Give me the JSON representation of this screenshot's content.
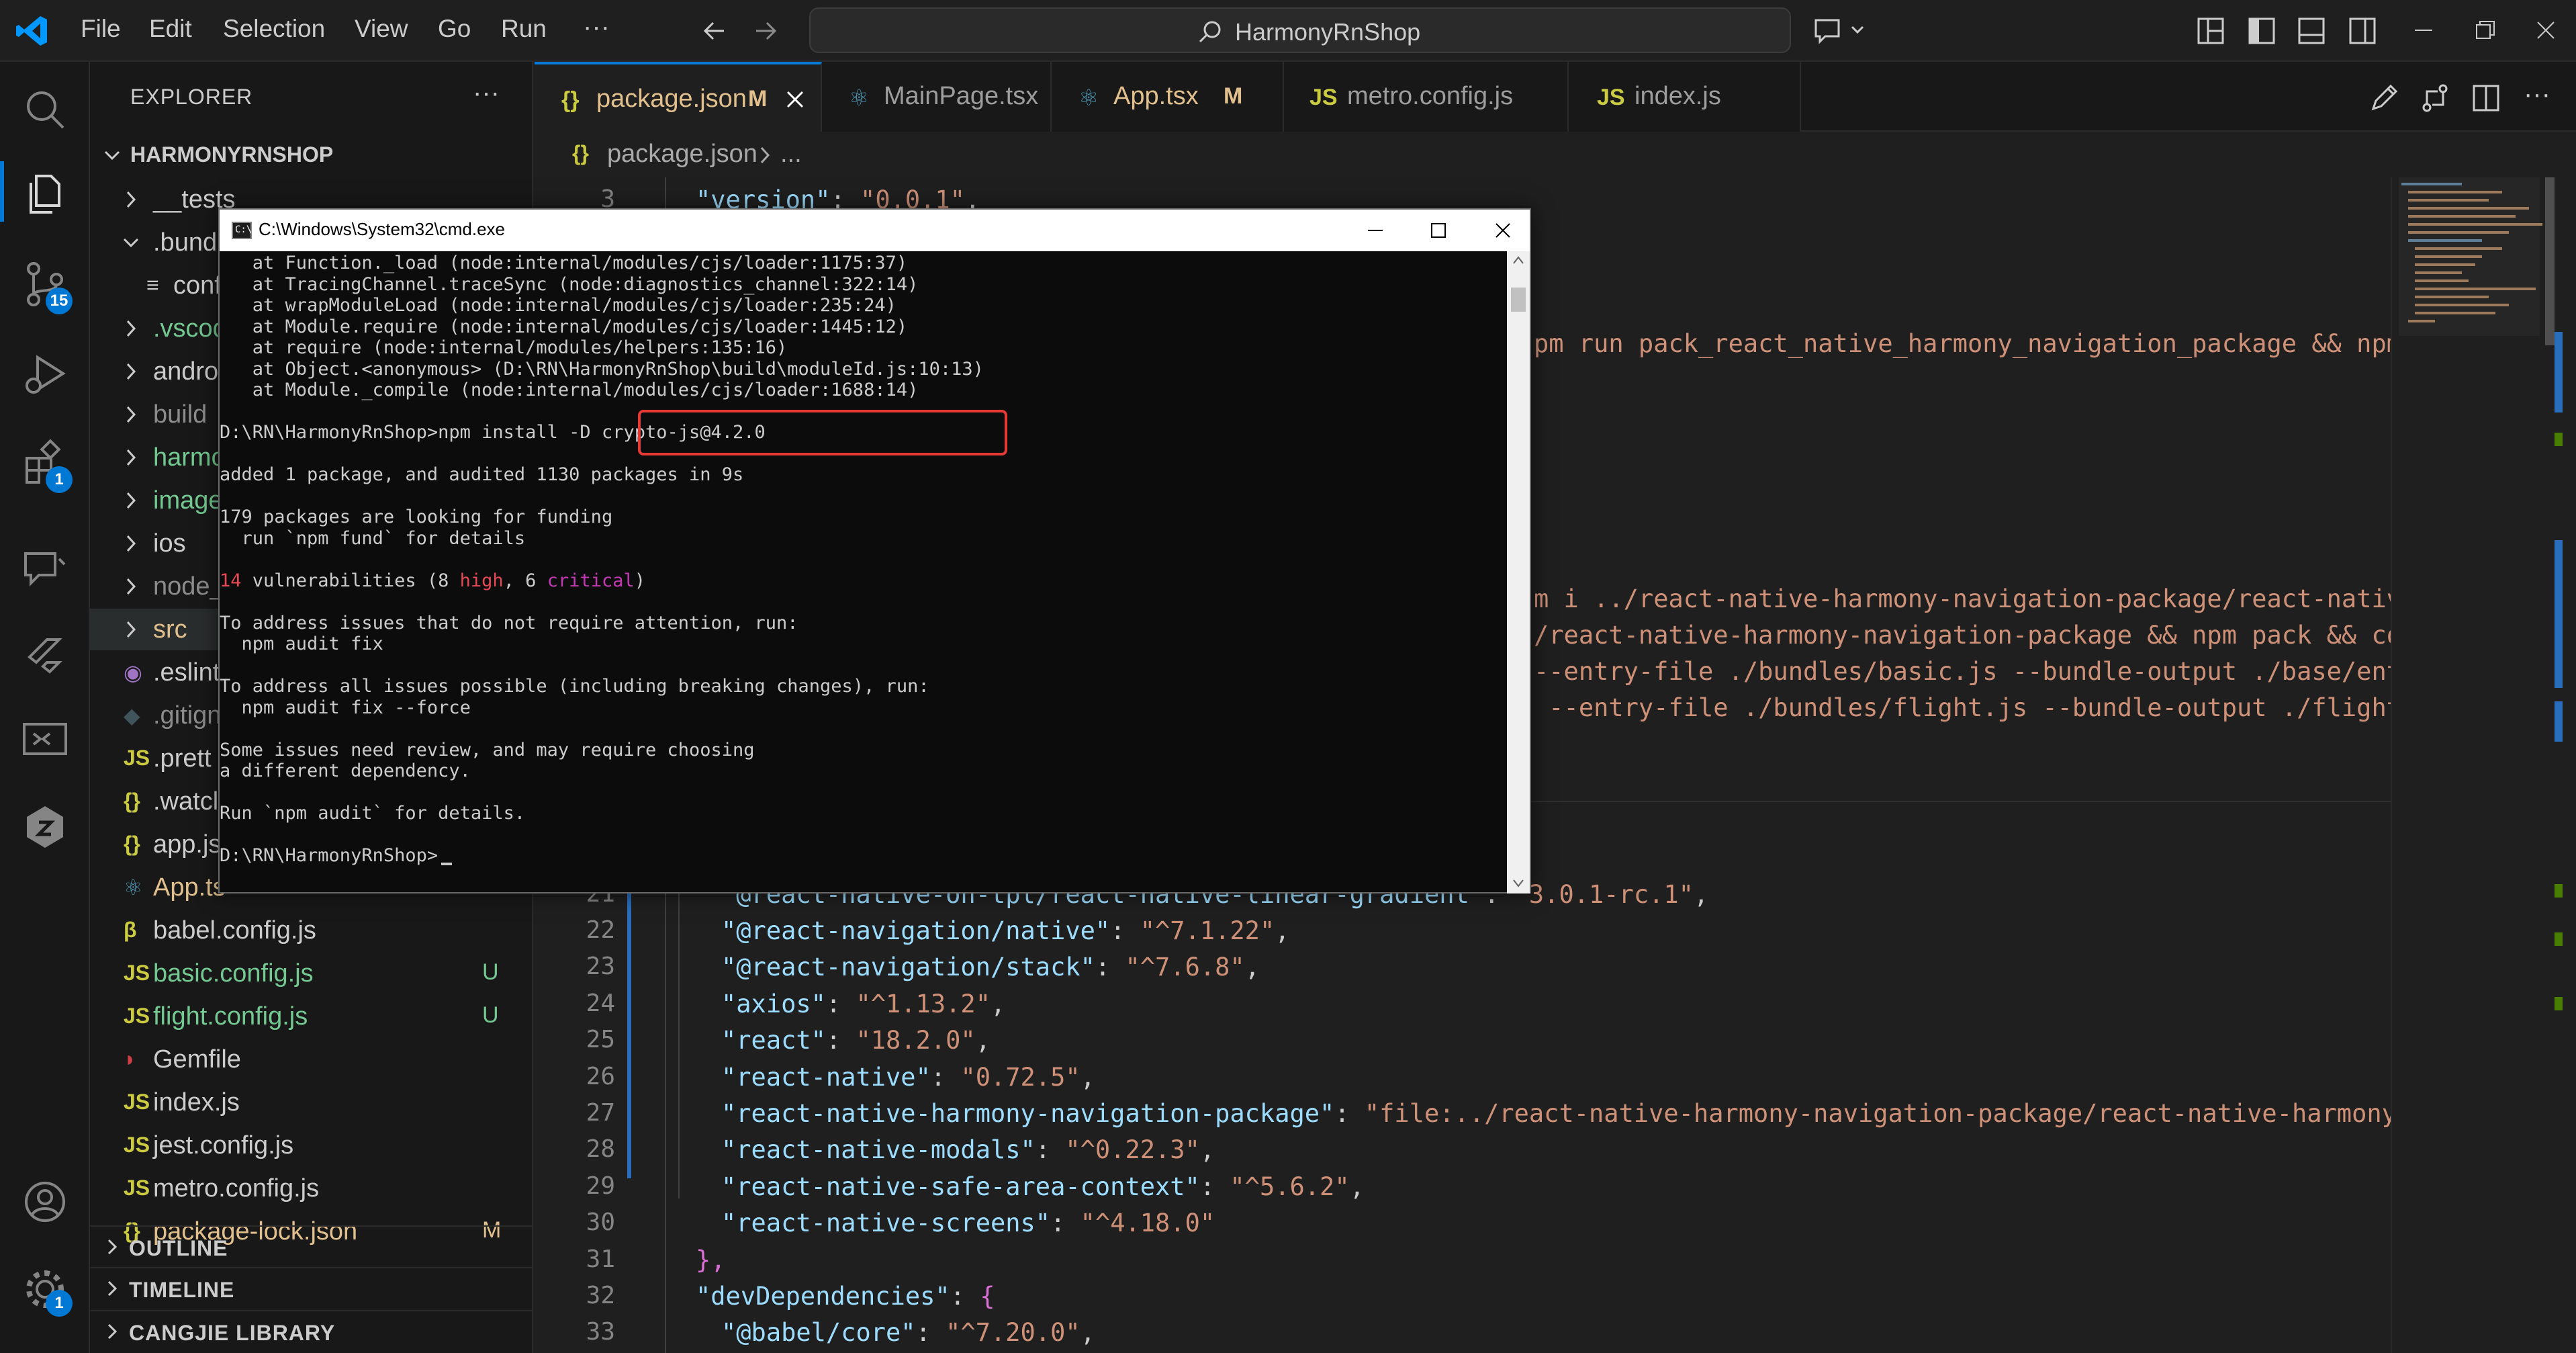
{
  "titlebar": {
    "menus": [
      "File",
      "Edit",
      "Selection",
      "View",
      "Go",
      "Run",
      "···"
    ],
    "search": "HarmonyRnShop"
  },
  "activity": {
    "scm_badge": "15",
    "extensions_badge": "1",
    "settings_badge": "1"
  },
  "sidebar": {
    "title": "EXPLORER",
    "more": "···",
    "root": "HARMONYRNSHOP",
    "items": [
      {
        "label": "__tests",
        "type": "folder",
        "open": false,
        "indent": 1,
        "color": "#cccccc"
      },
      {
        "label": ".bund",
        "type": "folder",
        "open": true,
        "indent": 1,
        "color": "#cccccc"
      },
      {
        "label": "conf",
        "type": "file",
        "icon": "≡",
        "indent": 2,
        "color": "#cccccc",
        "iconColor": "#cccccc"
      },
      {
        "label": ".vscod",
        "type": "folder",
        "open": false,
        "indent": 1,
        "color": "#73c991"
      },
      {
        "label": "andro",
        "type": "folder",
        "open": false,
        "indent": 1,
        "color": "#cccccc"
      },
      {
        "label": "build",
        "type": "folder",
        "open": false,
        "indent": 1,
        "color": "#8c8c8c"
      },
      {
        "label": "harmo",
        "type": "folder",
        "open": false,
        "indent": 1,
        "color": "#73c991"
      },
      {
        "label": "image",
        "type": "folder",
        "open": false,
        "indent": 1,
        "color": "#73c991"
      },
      {
        "label": "ios",
        "type": "folder",
        "open": false,
        "indent": 1,
        "color": "#cccccc"
      },
      {
        "label": "node_",
        "type": "folder",
        "open": false,
        "indent": 1,
        "color": "#8c8c8c"
      },
      {
        "label": "src",
        "type": "folder",
        "open": false,
        "indent": 1,
        "color": "#e2c08d",
        "selected": true
      },
      {
        "label": ".eslint",
        "type": "file",
        "icon": "◉",
        "indent": 1,
        "color": "#cccccc",
        "iconColor": "#a074c4"
      },
      {
        "label": ".gitign",
        "type": "file",
        "icon": "◆",
        "indent": 1,
        "color": "#8c8c8c",
        "iconColor": "#41535b"
      },
      {
        "label": ".prett",
        "type": "file",
        "icon": "JS",
        "indent": 1,
        "color": "#cccccc",
        "iconColor": "#cbcb41"
      },
      {
        "label": ".watcl",
        "type": "file",
        "icon": "{}",
        "indent": 1,
        "color": "#cccccc",
        "iconColor": "#cbcb41"
      },
      {
        "label": "app.js",
        "type": "file",
        "icon": "{}",
        "indent": 1,
        "color": "#cccccc",
        "iconColor": "#cbcb41"
      },
      {
        "label": "App.ts",
        "type": "file",
        "icon": "⚛",
        "indent": 1,
        "color": "#e2c08d",
        "iconColor": "#519aba"
      },
      {
        "label": "babel.config.js",
        "type": "file",
        "icon": "β",
        "indent": 1,
        "color": "#cccccc",
        "iconColor": "#cbcb41"
      },
      {
        "label": "basic.config.js",
        "type": "file",
        "icon": "JS",
        "indent": 1,
        "color": "#73c991",
        "iconColor": "#cbcb41",
        "status": "U"
      },
      {
        "label": "flight.config.js",
        "type": "file",
        "icon": "JS",
        "indent": 1,
        "color": "#73c991",
        "iconColor": "#cbcb41",
        "status": "U"
      },
      {
        "label": "Gemfile",
        "type": "file",
        "icon": "◗",
        "indent": 1,
        "color": "#cccccc",
        "iconColor": "#cc3e44"
      },
      {
        "label": "index.js",
        "type": "file",
        "icon": "JS",
        "indent": 1,
        "color": "#cccccc",
        "iconColor": "#cbcb41"
      },
      {
        "label": "jest.config.js",
        "type": "file",
        "icon": "JS",
        "indent": 1,
        "color": "#cccccc",
        "iconColor": "#cbcb41"
      },
      {
        "label": "metro.config.js",
        "type": "file",
        "icon": "JS",
        "indent": 1,
        "color": "#cccccc",
        "iconColor": "#cbcb41"
      },
      {
        "label": "package-lock.json",
        "type": "file",
        "icon": "{}",
        "indent": 1,
        "color": "#e2c08d",
        "iconColor": "#cbcb41",
        "status": "M"
      }
    ],
    "sections": [
      "OUTLINE",
      "TIMELINE",
      "CANGJIE LIBRARY"
    ]
  },
  "tabs": [
    {
      "icon": "{}",
      "label": "package.json",
      "mod": "M",
      "active": true,
      "iconColor": "#cbcb41",
      "labelColor": "#e2c08d"
    },
    {
      "icon": "⚛",
      "label": "MainPage.tsx",
      "mod": "",
      "active": false,
      "iconColor": "#519aba",
      "labelColor": "#9d9d9d"
    },
    {
      "icon": "⚛",
      "label": "App.tsx",
      "mod": "M",
      "active": false,
      "iconColor": "#519aba",
      "labelColor": "#e2c08d"
    },
    {
      "icon": "JS",
      "label": "metro.config.js",
      "mod": "",
      "active": false,
      "iconColor": "#cbcb41",
      "labelColor": "#9d9d9d"
    },
    {
      "icon": "JS",
      "label": "index.js",
      "mod": "",
      "active": false,
      "iconColor": "#cbcb41",
      "labelColor": "#9d9d9d"
    }
  ],
  "breadcrumb": {
    "icon": "{}",
    "file": "package.json",
    "rest": "..."
  },
  "editor": {
    "top_line": {
      "num": "3",
      "key": "\"version\"",
      "val": "\"0.0.1\""
    },
    "partial_lines": [
      "pm run pack_react_native_harmony_navigation_package && npm",
      "m i ../react-native-harmony-navigation-package/react-nativ",
      "/react-native-harmony-navigation-package && npm pack && co",
      "--entry-file ./bundles/basic.js --bundle-output ./base/ent",
      " --entry-file ./bundles/flight.js --bundle-output ./flight"
    ],
    "line21": {
      "num": "21",
      "key": "\"@react-native-oh-tpl/react-native-linear-gradient\"",
      "val": "\"3.0.1-rc.1\""
    },
    "lines": [
      {
        "num": "22",
        "key": "\"@react-navigation/native\"",
        "val": "\"^7.1.22\"",
        "comma": ","
      },
      {
        "num": "23",
        "key": "\"@react-navigation/stack\"",
        "val": "\"^7.6.8\"",
        "comma": ","
      },
      {
        "num": "24",
        "key": "\"axios\"",
        "val": "\"^1.13.2\"",
        "comma": ","
      },
      {
        "num": "25",
        "key": "\"react\"",
        "val": "\"18.2.0\"",
        "comma": ","
      },
      {
        "num": "26",
        "key": "\"react-native\"",
        "val": "\"0.72.5\"",
        "comma": ","
      },
      {
        "num": "27",
        "key": "\"react-native-harmony-navigation-package\"",
        "val": "\"file:../react-native-harmony-navigation-package/react-native-harmony",
        "comma": ""
      },
      {
        "num": "28",
        "key": "\"react-native-modals\"",
        "val": "\"^0.22.3\"",
        "comma": ","
      },
      {
        "num": "29",
        "key": "\"react-native-safe-area-context\"",
        "val": "\"^5.6.2\"",
        "comma": ","
      },
      {
        "num": "30",
        "key": "\"react-native-screens\"",
        "val": "\"^4.18.0\"",
        "comma": ""
      }
    ],
    "line31": {
      "num": "31",
      "text": "},"
    },
    "line32": {
      "num": "32",
      "key": "\"devDependencies\"",
      "brace": "{"
    },
    "line33": {
      "num": "33",
      "key": "\"@babel/core\"",
      "val": "\"^7.20.0\"",
      "comma": ","
    }
  },
  "cmd": {
    "title": "C:\\Windows\\System32\\cmd.exe",
    "lines": [
      "   at Function._load (node:internal/modules/cjs/loader:1175:37)",
      "   at TracingChannel.traceSync (node:diagnostics_channel:322:14)",
      "   at wrapModuleLoad (node:internal/modules/cjs/loader:235:24)",
      "   at Module.require (node:internal/modules/cjs/loader:1445:12)",
      "   at require (node:internal/modules/helpers:135:16)",
      "   at Object.<anonymous> (D:\\RN\\HarmonyRnShop\\build\\moduleId.js:10:13)",
      "   at Module._compile (node:internal/modules/cjs/loader:1688:14)",
      "",
      "D:\\RN\\HarmonyRnShop>npm install -D crypto-js@4.2.0",
      "",
      "added 1 package, and audited 1130 packages in 9s",
      "",
      "179 packages are looking for funding",
      "  run `npm fund` for details",
      "",
      "",
      "",
      "To address issues that do not require attention, run:",
      "  npm audit fix",
      "",
      "To address all issues possible (including breaking changes), run:",
      "  npm audit fix --force",
      "",
      "Some issues need review, and may require choosing",
      "a different dependency.",
      "",
      "Run `npm audit` for details.",
      "",
      "D:\\RN\\HarmonyRnShop>"
    ],
    "vuln": {
      "count": "14",
      "text": " vulnerabilities (8 ",
      "high": "high",
      ", ": ", 6 ",
      "critical": "critical",
      "end": ")"
    }
  }
}
